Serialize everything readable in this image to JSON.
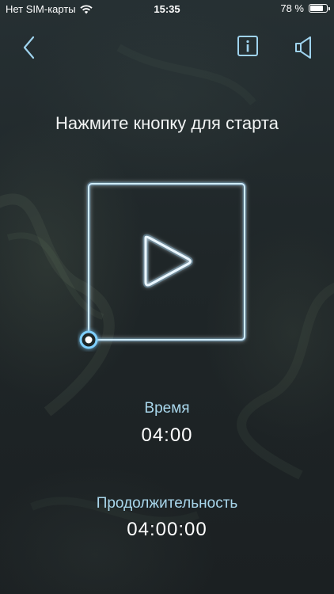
{
  "status_bar": {
    "carrier": "Нет SIM-карты",
    "time": "15:35",
    "battery_text": "78 %",
    "battery_level": 0.78,
    "wifi_icon": "wifi-icon",
    "battery_icon": "battery-icon"
  },
  "nav": {
    "back_icon": "chevron-left-icon",
    "info_icon": "info-icon",
    "sound_icon": "speaker-icon"
  },
  "main": {
    "prompt": "Нажмите кнопку для старта",
    "play_icon": "play-icon",
    "time_label": "Время",
    "time_value": "04:00",
    "duration_label": "Продолжительность",
    "duration_value": "04:00:00"
  },
  "colors": {
    "accent": "#a9d7ec",
    "glow": "#7fd0ff",
    "background": "#1f2628"
  }
}
